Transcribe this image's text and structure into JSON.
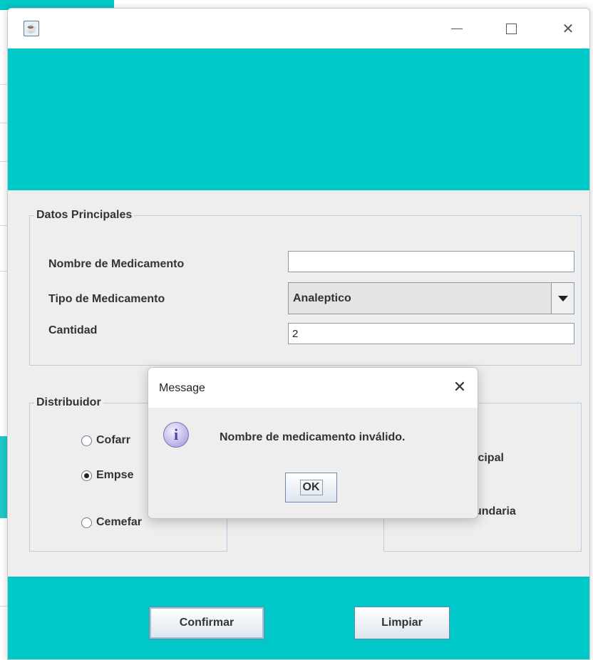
{
  "window": {
    "title": "",
    "controls": {
      "minimize_icon": "minimize-icon",
      "maximize_icon": "maximize-icon",
      "close_icon": "close-icon",
      "close_glyph": "✕"
    }
  },
  "colors": {
    "accent_band": "#00c8c8",
    "panel_bg": "#eeeeee",
    "group_border": "#b7cde0"
  },
  "datos": {
    "title": "Datos Principales",
    "nombre_label": "Nombre de Medicamento",
    "nombre_value": "",
    "tipo_label": "Tipo de Medicamento",
    "tipo_value": "Analeptico",
    "cantidad_label": "Cantidad",
    "cantidad_value": "2"
  },
  "distribuidor": {
    "title": "Distribuidor",
    "options": [
      {
        "label": "Cofarma",
        "visible_text": "Cofarr",
        "selected": false
      },
      {
        "label": "Empsephar",
        "visible_text": "Empse",
        "selected": true
      },
      {
        "label": "Cemefar",
        "visible_text": "Cemefar",
        "selected": false
      }
    ]
  },
  "sucursal": {
    "options": [
      {
        "visible_text": "icipal"
      },
      {
        "visible_text": "undaria"
      }
    ]
  },
  "buttons": {
    "confirmar": "Confirmar",
    "limpiar": "Limpiar"
  },
  "dialog": {
    "title": "Message",
    "close_glyph": "✕",
    "icon": "info-icon",
    "icon_glyph": "i",
    "message": "Nombre de medicamento inválido.",
    "ok_label": "OK"
  }
}
